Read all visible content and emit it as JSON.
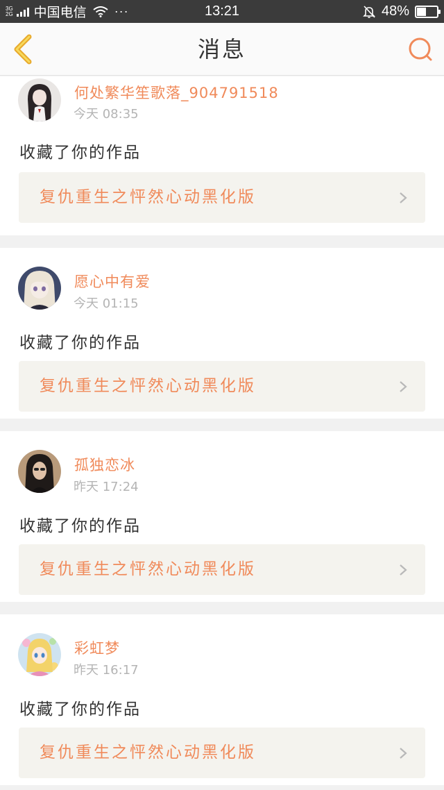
{
  "status_bar": {
    "network_top": "3G",
    "network_bottom": "2G",
    "carrier": "中国电信",
    "more": "···",
    "time": "13:21",
    "battery_percent_text": "48%",
    "battery_level": 0.48
  },
  "nav": {
    "title": "消息",
    "back_icon": "chevron-left-icon",
    "search_icon": "search-icon",
    "accent_color": "#f5a623",
    "search_color": "#f08a5a"
  },
  "messages": [
    {
      "username": "何处繁华笙歌落_904791518",
      "time": "今天 08:35",
      "action": "收藏了你的作品",
      "work_title": "复仇重生之怦然心动黑化版",
      "avatar": "avatar-girl-long-dark-hair"
    },
    {
      "username": "愿心中有爱",
      "time": "今天 01:15",
      "action": "收藏了你的作品",
      "work_title": "复仇重生之怦然心动黑化版",
      "avatar": "avatar-anime-blonde"
    },
    {
      "username": "孤独恋冰",
      "time": "昨天 17:24",
      "action": "收藏了你的作品",
      "work_title": "复仇重生之怦然心动黑化版",
      "avatar": "avatar-girl-dark-photo"
    },
    {
      "username": "彩虹梦",
      "time": "昨天 16:17",
      "action": "收藏了你的作品",
      "work_title": "复仇重生之怦然心动黑化版",
      "avatar": "avatar-anime-colorful"
    }
  ]
}
